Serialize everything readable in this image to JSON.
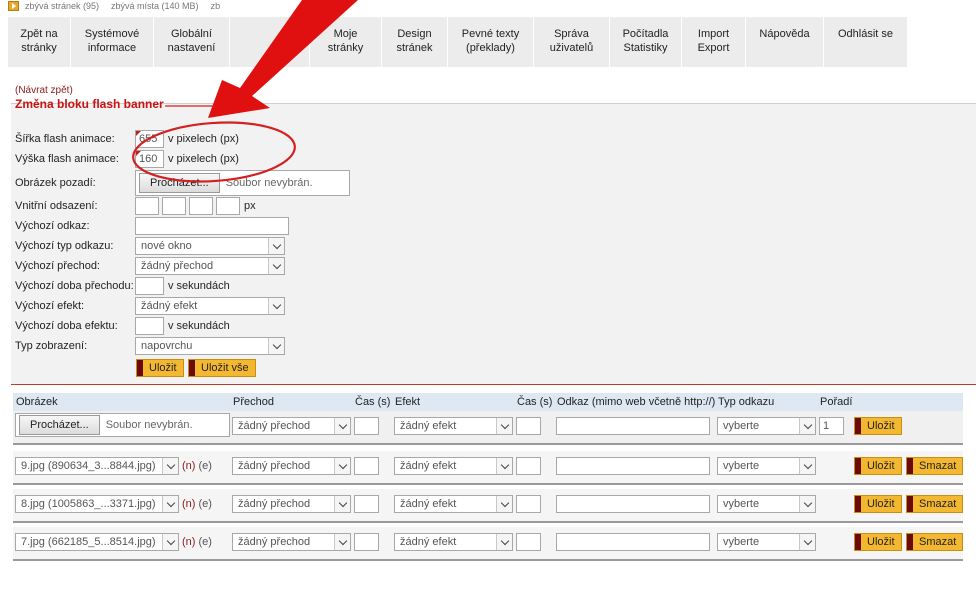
{
  "topbar": {
    "pages_left": "zbývá stránek (95)",
    "space_left": "zbývá místa (140 MB)",
    "cut": "zb"
  },
  "menu": [
    {
      "label": "Zpět na\nstránky",
      "w": 63
    },
    {
      "label": "Systémové\ninformace",
      "w": 83
    },
    {
      "label": "Globální\nnastavení",
      "w": 76
    },
    {
      "label": "",
      "w": 80
    },
    {
      "label": "Moje\nstránky",
      "w": 72
    },
    {
      "label": "Design\nstránek",
      "w": 66
    },
    {
      "label": "Pevné texty\n(překlady)",
      "w": 86
    },
    {
      "label": "Správa\nuživatelů",
      "w": 76
    },
    {
      "label": "Počítadla\nStatistiky",
      "w": 72
    },
    {
      "label": "Import\nExport",
      "w": 64
    },
    {
      "label": "Nápověda",
      "w": 78
    },
    {
      "label": "Odhlásit se",
      "w": 84
    }
  ],
  "back_link": "(Návrat zpět)",
  "panel_title": "Změna bloku flash banner",
  "form": {
    "width_label": "Šířka flash animace:",
    "width_value": "655",
    "height_label": "Výška flash animace:",
    "height_value": "160",
    "px_unit": "v pixelech (px)",
    "bg_label": "Obrázek pozadí:",
    "browse": "Procházet...",
    "no_file": "Soubor nevybrán.",
    "padding_label": "Vnitřní odsazení:",
    "px_short": "px",
    "link_label": "Výchozí odkaz:",
    "link_type_label": "Výchozí typ odkazu:",
    "link_type_value": "nové okno",
    "transition_label": "Výchozí přechod:",
    "transition_value": "žádný přechod",
    "transition_time_label": "Výchozí doba přechodu:",
    "seconds": "v sekundách",
    "effect_label": "Výchozí efekt:",
    "effect_value": "žádný efekt",
    "effect_time_label": "Výchozí doba efektu:",
    "display_label": "Typ zobrazení:",
    "display_value": "napovrchu",
    "save": "Uložit",
    "save_all": "Uložit vše"
  },
  "table": {
    "headers": [
      "Obrázek",
      "Přechod",
      "Čas (s)",
      "Efekt",
      "Čas (s)",
      "Odkaz (mimo web včetně http://)",
      "Typ odkazu",
      "Pořadí"
    ],
    "new_row": {
      "browse": "Procházet...",
      "no_file": "Soubor nevybrán.",
      "transition": "žádný přechod",
      "effect": "žádný efekt",
      "link_type": "vyberte",
      "order": "1",
      "save": "Uložit"
    },
    "rows": [
      {
        "image": "9.jpg (890634_3...8844.jpg)",
        "n": "(n)",
        "e": "(e)",
        "transition": "žádný přechod",
        "effect": "žádný efekt",
        "link_type": "vyberte",
        "save": "Uložit",
        "delete": "Smazat"
      },
      {
        "image": "8.jpg (1005863_...3371.jpg)",
        "n": "(n)",
        "e": "(e)",
        "transition": "žádný přechod",
        "effect": "žádný efekt",
        "link_type": "vyberte",
        "save": "Uložit",
        "delete": "Smazat"
      },
      {
        "image": "7.jpg (662185_5...8514.jpg)",
        "n": "(n)",
        "e": "(e)",
        "transition": "žádný přechod",
        "effect": "žádný efekt",
        "link_type": "vyberte",
        "save": "Uložit",
        "delete": "Smazat"
      }
    ]
  },
  "colors": {
    "accent": "#cc1111",
    "button": "#f3b730",
    "button_edge": "#6b0a0a",
    "header_row": "#dde8f3"
  }
}
